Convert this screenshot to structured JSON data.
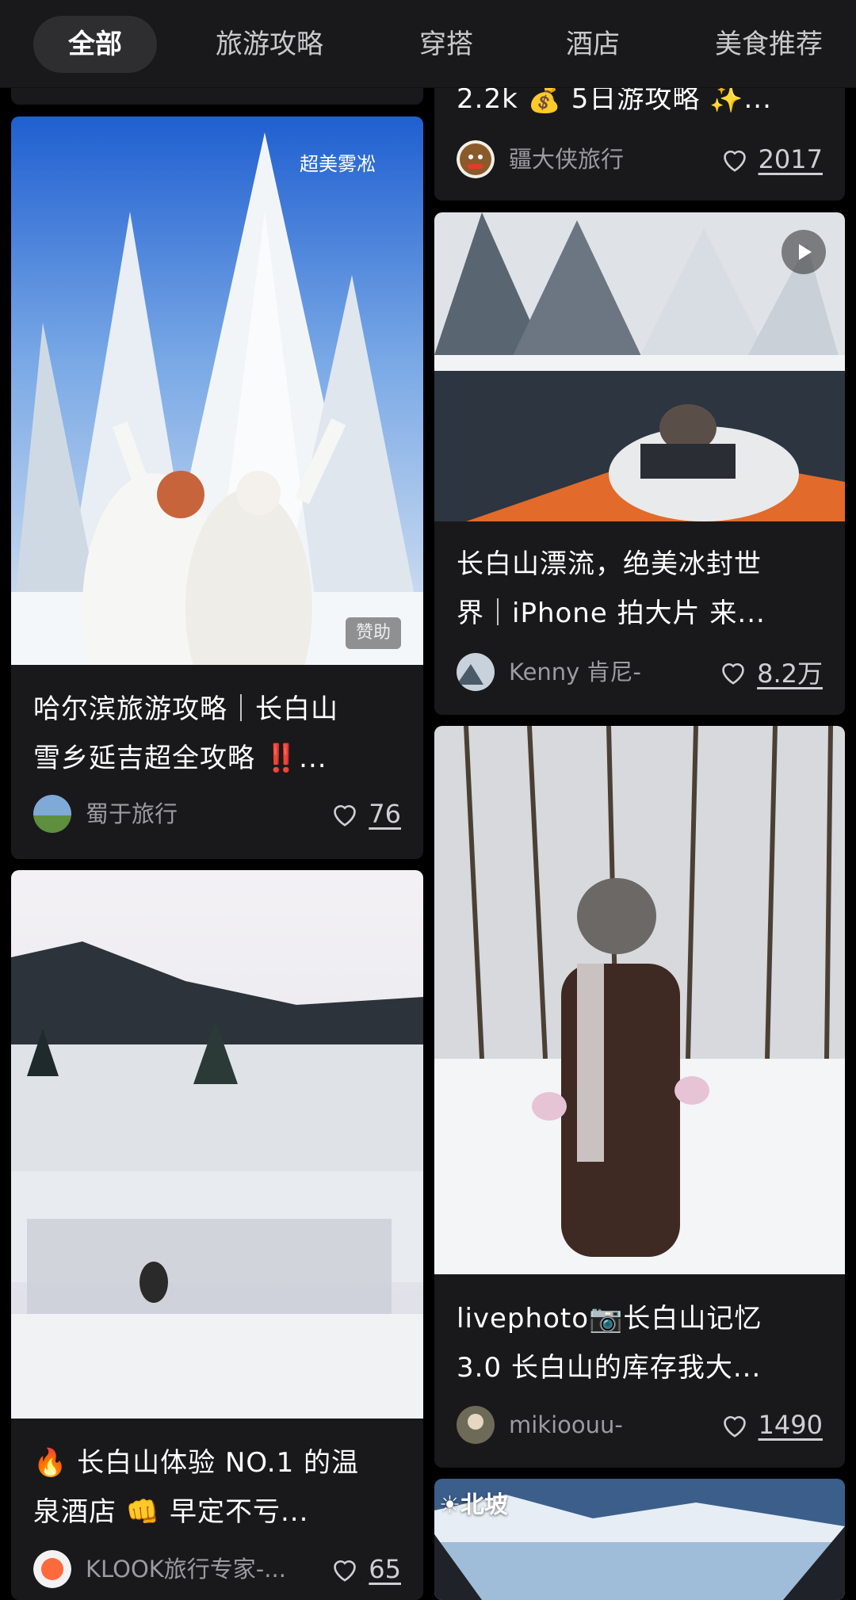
{
  "tabs": [
    "全部",
    "旅游攻略",
    "穿搭",
    "酒店",
    "美食推荐"
  ],
  "cards": [
    {
      "title_line1": "2.2k 💰 5日游攻略 ✨...",
      "author": "疆大侠旅行",
      "likes": "2017"
    },
    {
      "title_line1": "哈尔滨旅游攻略｜长白山",
      "title_line2": "雪乡延吉超全攻略 ‼️...",
      "author": "蜀于旅行",
      "likes": "76",
      "overlay_text": "超美雾凇",
      "sponsor_label": "赞助"
    },
    {
      "title_line1": "长白山漂流，绝美冰封世",
      "title_line2": "界｜iPhone 拍大片 来...",
      "author": "Kenny 肯尼-",
      "likes": "8.2万",
      "play_icon": "play-icon"
    },
    {
      "title_line1": "🔥 长白山体验 NO.1 的温",
      "title_line2": "泉酒店 👊 早定不亏...",
      "author": "KLOOK旅行专家-...",
      "likes": "65"
    },
    {
      "title_line1": "livephoto📷长白山记忆",
      "title_line2": "3.0 长白山的库存我大...",
      "author": "mikioouu-",
      "likes": "1490"
    },
    {
      "badge": "☀北坡"
    }
  ],
  "colors": {
    "background": "#000000",
    "card": "#19191b",
    "tab_active": "#2e2e31",
    "text_muted": "#9b9ba0"
  },
  "icons": {
    "like": "heart-outline-icon"
  }
}
